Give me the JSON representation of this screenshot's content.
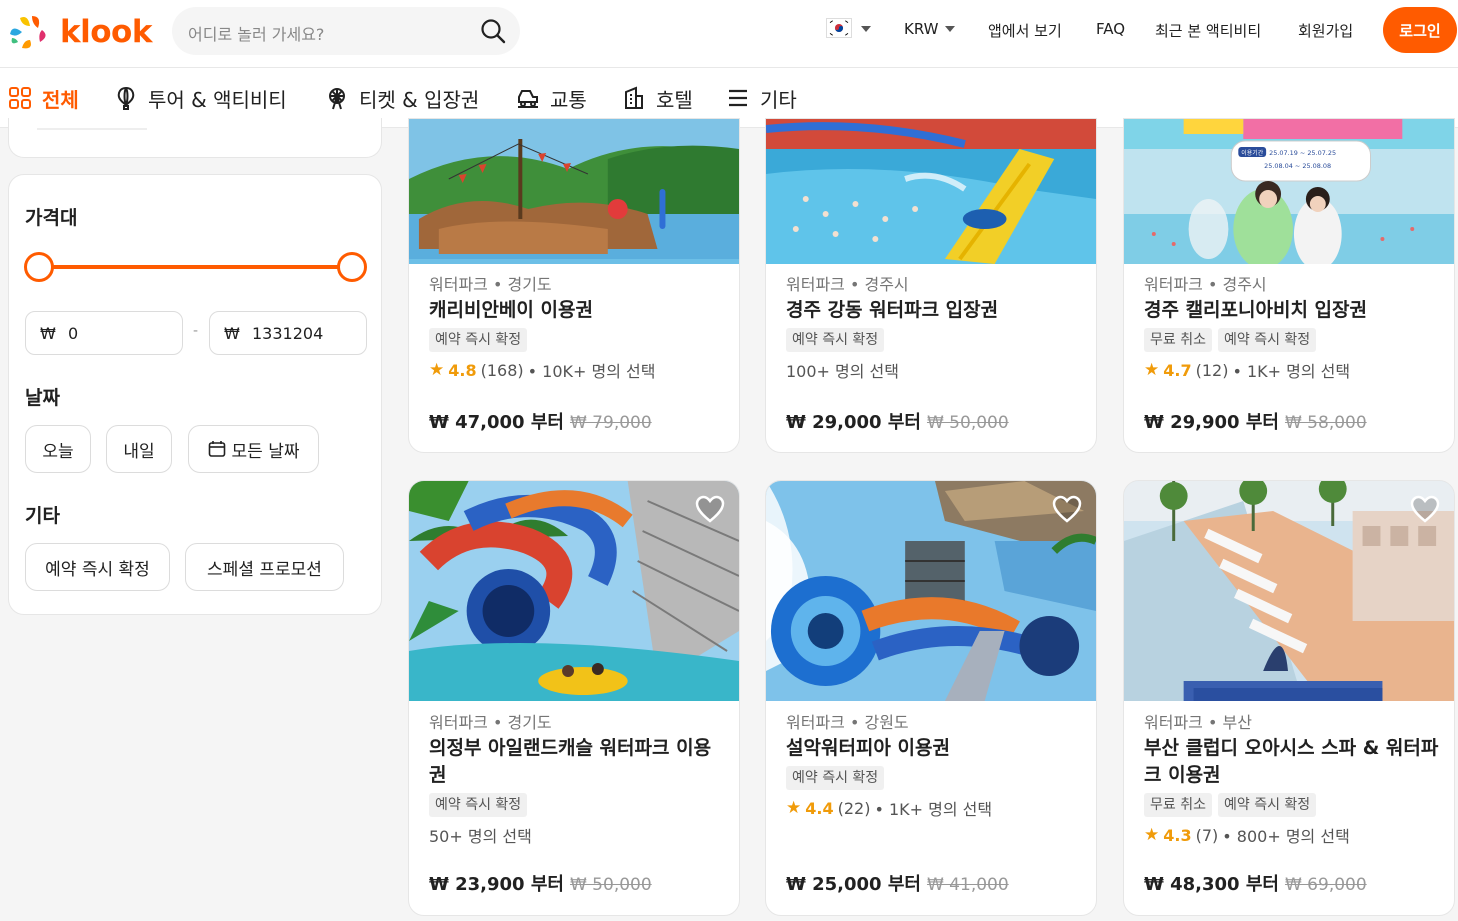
{
  "header": {
    "logo_text": "klook",
    "search_placeholder": "어디로 놀러 가세요?",
    "currency": "KRW",
    "links": [
      "앱에서 보기",
      "FAQ",
      "최근 본 액티비티",
      "회원가입"
    ],
    "login_label": "로그인",
    "accent_color": "#ff5b00"
  },
  "categories": [
    {
      "label": "전체",
      "icon": "grid-icon",
      "active": true
    },
    {
      "label": "투어 & 액티비티",
      "icon": "balloon-icon"
    },
    {
      "label": "티켓 & 입장권",
      "icon": "ferris-wheel-icon"
    },
    {
      "label": "교통",
      "icon": "car-icon"
    },
    {
      "label": "호텔",
      "icon": "hotel-icon"
    },
    {
      "label": "기타",
      "icon": "menu-icon"
    }
  ],
  "filters": {
    "price_title": "가격대",
    "price_currency": "₩",
    "price_min": "0",
    "price_max": "1331204",
    "price_dash": "-",
    "date_title": "날짜",
    "date_options": [
      "오늘",
      "내일",
      "모든 날짜"
    ],
    "other_title": "기타",
    "other_options": [
      "예약 즉시 확정",
      "스페셜 프로모션"
    ]
  },
  "cards": [
    {
      "crumb": "워터파크 • 경기도",
      "title": "캐리비안베이 이용권",
      "tags": [
        "예약 즉시 확정"
      ],
      "score": "4.8",
      "reviews": "(168)",
      "booked": "• 10K+ 명의 선택",
      "price": "₩ 47,000 부터",
      "old_price": "₩ 79,000"
    },
    {
      "crumb": "워터파크 • 경주시",
      "title": "경주 강동 워터파크 입장권",
      "tags": [
        "예약 즉시 확정"
      ],
      "score": "",
      "reviews": "",
      "booked": "100+ 명의 선택",
      "price": "₩ 29,000 부터",
      "old_price": "₩ 50,000"
    },
    {
      "crumb": "워터파크 • 경주시",
      "title": "경주 캘리포니아비치 입장권",
      "tags": [
        "무료 취소",
        "예약 즉시 확정"
      ],
      "score": "4.7",
      "reviews": "(12)",
      "booked": "• 1K+ 명의 선택",
      "price": "₩ 29,900 부터",
      "old_price": "₩ 58,000",
      "image_text": [
        "이용기간",
        "25.07.19 ~ 25.07.25",
        "25.08.04 ~ 25.08.08"
      ]
    },
    {
      "crumb": "워터파크 • 경기도",
      "title": "의정부 아일랜드캐슬 워터파크 이용권",
      "tags": [
        "예약 즉시 확정"
      ],
      "score": "",
      "reviews": "",
      "booked": "50+ 명의 선택",
      "price": "₩ 23,900 부터",
      "old_price": "₩ 50,000"
    },
    {
      "crumb": "워터파크 • 강원도",
      "title": "설악워터피아 이용권",
      "tags": [
        "예약 즉시 확정"
      ],
      "score": "4.4",
      "reviews": "(22)",
      "booked": "• 1K+ 명의 선택",
      "price": "₩ 25,000 부터",
      "old_price": "₩ 41,000"
    },
    {
      "crumb": "워터파크 • 부산",
      "title": "부산 클럽디 오아시스 스파 & 워터파크 이용권",
      "tags": [
        "무료 취소",
        "예약 즉시 확정"
      ],
      "score": "4.3",
      "reviews": "(7)",
      "booked": "• 800+ 명의 선택",
      "price": "₩ 48,300 부터",
      "old_price": "₩ 69,000"
    }
  ]
}
